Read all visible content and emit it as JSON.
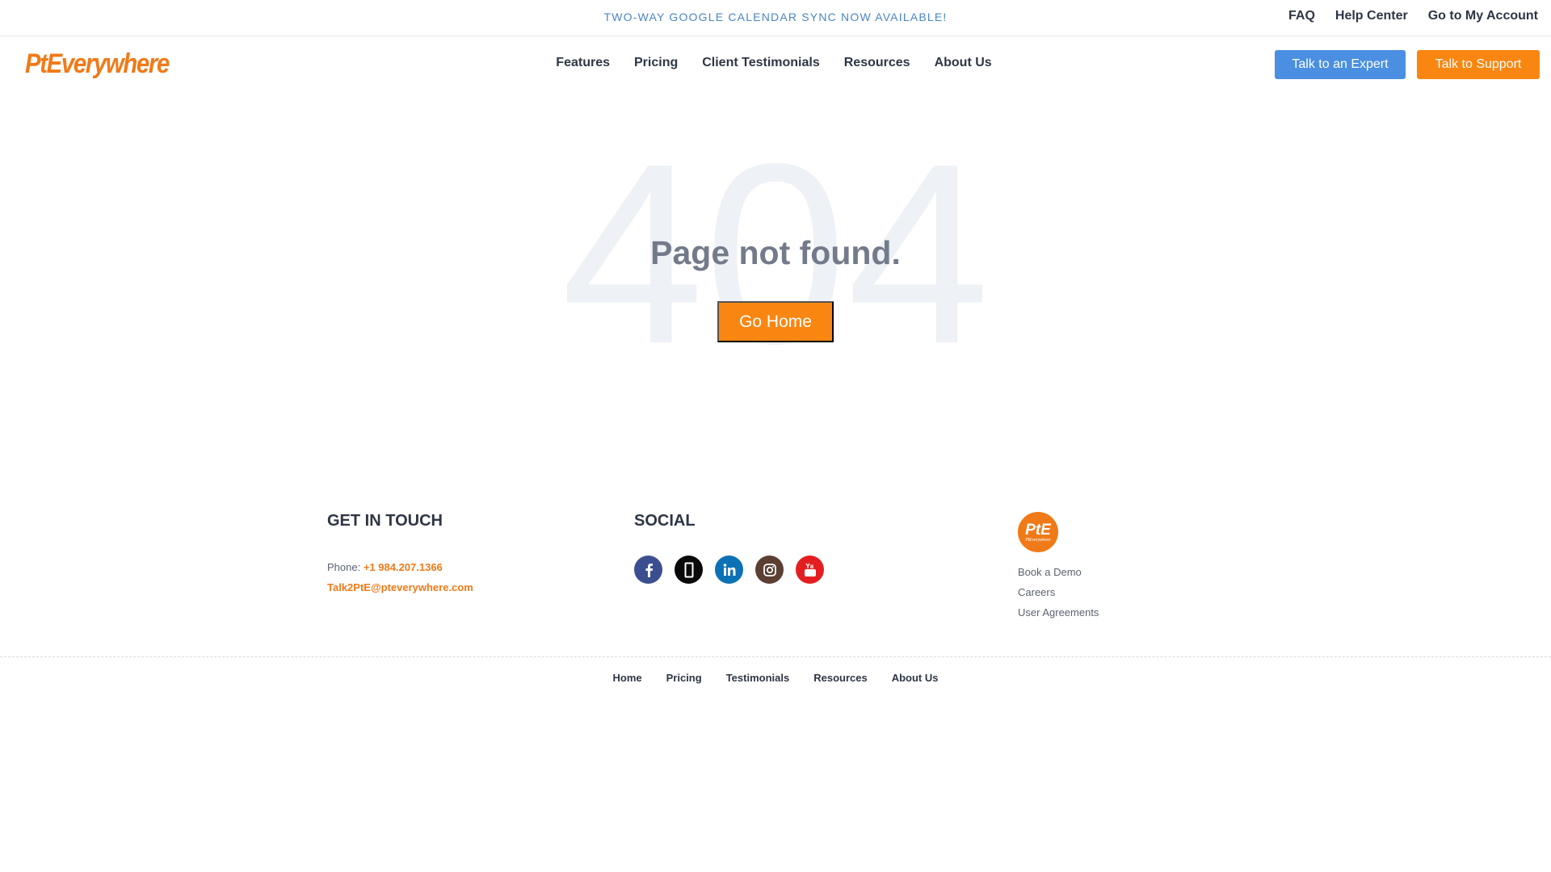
{
  "topbar": {
    "announcement": "TWO-WAY GOOGLE CALENDAR SYNC NOW AVAILABLE!",
    "links": [
      "FAQ",
      "Help Center",
      "Go to My Account"
    ]
  },
  "header": {
    "logo": "PtEverywhere",
    "nav": [
      "Features",
      "Pricing",
      "Client Testimonials",
      "Resources",
      "About Us"
    ],
    "expert_button": "Talk to an Expert",
    "support_button": "Talk to Support"
  },
  "main": {
    "bg_code": "404",
    "title": "Page not found.",
    "go_home": "Go Home"
  },
  "footer": {
    "contact": {
      "heading": "GET IN TOUCH",
      "phone_label": "Phone:",
      "phone": "+1 984.207.1366",
      "email": "Talk2PtE@pteverywhere.com"
    },
    "social": {
      "heading": "SOCIAL",
      "icons": [
        "facebook-icon",
        "x-icon",
        "linkedin-icon",
        "instagram-icon",
        "youtube-icon"
      ]
    },
    "badge": {
      "big": "PtE",
      "small": "PtEverywhere"
    },
    "links": [
      "Book a Demo",
      "Careers",
      "User Agreements"
    ],
    "bottom_nav": [
      "Home",
      "Pricing",
      "Testimonials",
      "Resources",
      "About Us"
    ]
  },
  "colors": {
    "brand_orange": "#f88611",
    "expert_blue": "#4a8fe2",
    "announcement_blue": "#4a86c5"
  }
}
